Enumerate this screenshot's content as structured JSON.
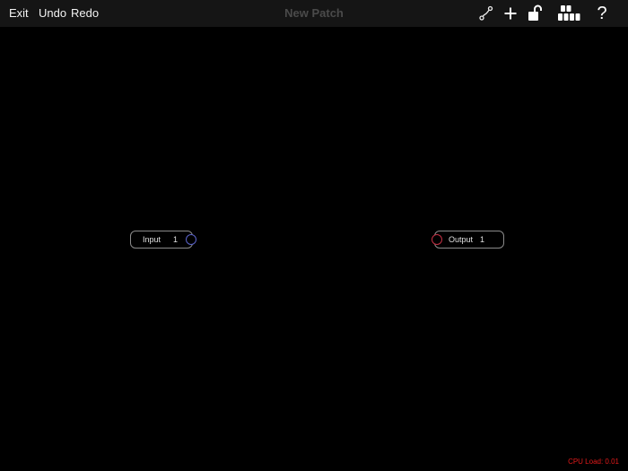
{
  "toolbar": {
    "exit_label": "Exit",
    "undo_label": "Undo",
    "redo_label": "Redo",
    "title": "New Patch",
    "icons": [
      "cable-icon",
      "plus-icon",
      "unlock-icon",
      "modules-icon",
      "help-icon"
    ],
    "help_label": "?"
  },
  "nodes": {
    "input": {
      "name": "Input",
      "channel": "1",
      "port_color": "#5a62c8"
    },
    "output": {
      "name": "Output",
      "channel": "1",
      "port_color": "#c23044"
    }
  },
  "status": {
    "cpu_load": "CPU Load: 0.01",
    "color": "#e21a1a"
  },
  "colors": {
    "background": "#000000",
    "toolbar": "#151515",
    "title": "#4a4a4a"
  }
}
